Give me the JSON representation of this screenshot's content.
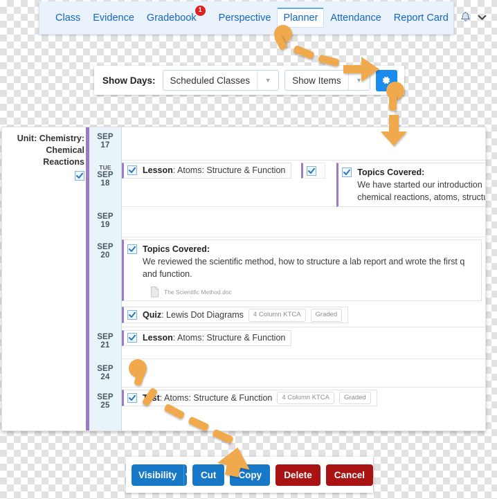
{
  "nav": {
    "items": [
      {
        "label": "Class",
        "active": false
      },
      {
        "label": "Evidence",
        "active": false
      },
      {
        "label": "Gradebook",
        "active": false,
        "badge": "1"
      },
      {
        "label": "Perspective",
        "active": false
      },
      {
        "label": "Planner",
        "active": true
      },
      {
        "label": "Attendance",
        "active": false
      },
      {
        "label": "Report Card",
        "active": false
      }
    ],
    "bell_icon": "bell-icon",
    "chevron_icon": "chevron-down-icon"
  },
  "toolbar": {
    "show_days_label": "Show Days:",
    "days_select_value": "Scheduled Classes",
    "items_select_value": "Show Items",
    "gear_icon": "gear-icon",
    "caret_icon": "caret-down-icon"
  },
  "unit": {
    "title": "Unit: Chemistry: Chemical Reactions",
    "checked": true
  },
  "planner": {
    "days": [
      {
        "dow": "",
        "month": "SEP",
        "day": "17",
        "items": []
      },
      {
        "dow": "TUE",
        "month": "SEP",
        "day": "18",
        "items": [
          {
            "kind": "lesson",
            "type_label": "Lesson",
            "title": "Atoms: Structure & Function"
          },
          {
            "kind": "mini",
            "type_label": "",
            "title": ""
          },
          {
            "kind": "topics",
            "title": "Topics Covered:",
            "body_line1": "We have started our introduction",
            "body_line2": "chemical reactions, atoms, structu"
          }
        ]
      },
      {
        "dow": "",
        "month": "SEP",
        "day": "19",
        "items": []
      },
      {
        "dow": "",
        "month": "SEP",
        "day": "20",
        "items": [
          {
            "kind": "topics-full",
            "title": "Topics Covered:",
            "body_line1": "We reviewed the scientific method, how to structure a lab report and wrote the first q",
            "body_line2": "and function.",
            "attachment": "The Scientific Method.doc"
          },
          {
            "kind": "quiz",
            "type_label": "Quiz",
            "title": "Lewis Dot Diagrams",
            "badges": [
              "4 Column KTCA",
              "Graded"
            ]
          }
        ]
      },
      {
        "dow": "",
        "month": "SEP",
        "day": "21",
        "items": [
          {
            "kind": "lesson",
            "type_label": "Lesson",
            "title": "Atoms: Structure & Function"
          }
        ]
      },
      {
        "dow": "",
        "month": "SEP",
        "day": "24",
        "items": []
      },
      {
        "dow": "",
        "month": "SEP",
        "day": "25",
        "items": [
          {
            "kind": "test",
            "type_label": "Test",
            "title": "Atoms: Structure & Function",
            "badges": [
              "4 Column KTCA",
              "Graded"
            ]
          }
        ]
      }
    ]
  },
  "actions": {
    "visibility_label": "Visibility",
    "visibility_caret": "caret-down-icon",
    "cut_label": "Cut",
    "copy_label": "Copy",
    "delete_label": "Delete",
    "cancel_label": "Cancel"
  },
  "colors": {
    "accent_blue": "#1a8cf0",
    "button_blue": "#1878c8",
    "danger_red": "#a91313",
    "annotation_orange": "#f0a94c",
    "unit_purple": "#9b7cc4",
    "badge_red": "#e02020",
    "date_col_bg": "#e9f4fa",
    "nav_bg": "#eaf2fb"
  }
}
